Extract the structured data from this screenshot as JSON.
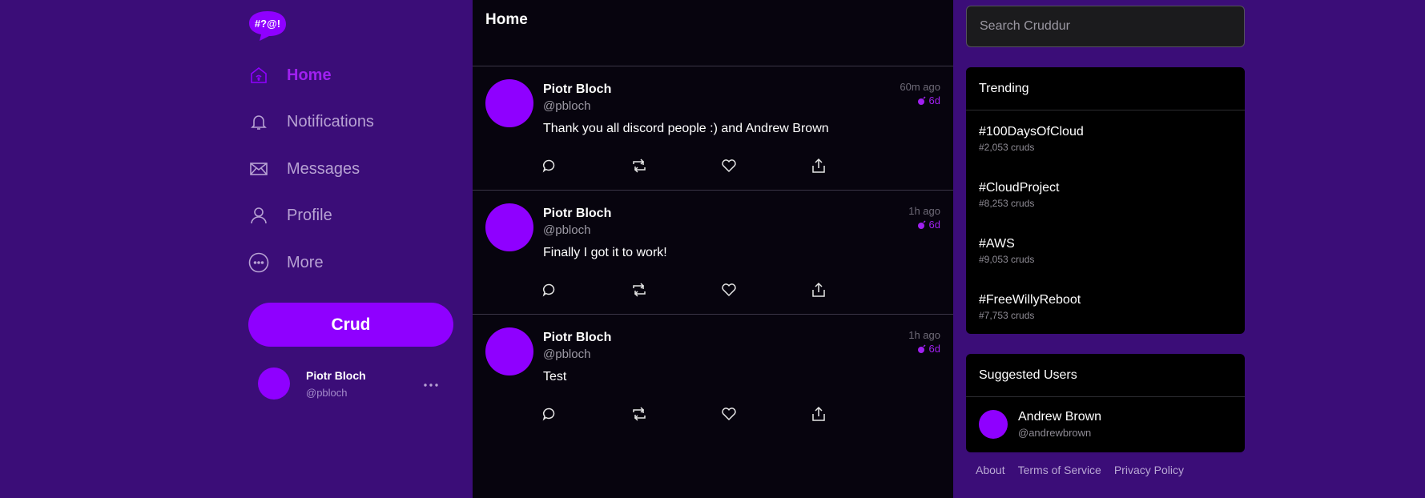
{
  "brand": {
    "logo_text": "#?@!",
    "accent": "#8f00ff",
    "active_color": "#a020f0"
  },
  "nav": {
    "items": [
      {
        "label": "Home",
        "icon": "home-icon",
        "active": true
      },
      {
        "label": "Notifications",
        "icon": "bell-icon",
        "active": false
      },
      {
        "label": "Messages",
        "icon": "envelope-icon",
        "active": false
      },
      {
        "label": "Profile",
        "icon": "user-icon",
        "active": false
      },
      {
        "label": "More",
        "icon": "more-circle-icon",
        "active": false
      }
    ],
    "crud_button": "Crud"
  },
  "current_user": {
    "display_name": "Piotr Bloch",
    "handle": "@pbloch",
    "menu_icon": "ellipsis-icon"
  },
  "feed": {
    "title": "Home",
    "posts": [
      {
        "author": "Piotr Bloch",
        "handle": "@pbloch",
        "message": "Thank you all discord people :) and Andrew Brown",
        "time": "60m ago",
        "expires": "6d"
      },
      {
        "author": "Piotr Bloch",
        "handle": "@pbloch",
        "message": "Finally I got it to work!",
        "time": "1h ago",
        "expires": "6d"
      },
      {
        "author": "Piotr Bloch",
        "handle": "@pbloch",
        "message": "Test",
        "time": "1h ago",
        "expires": "6d"
      }
    ],
    "action_icons": [
      "reply-icon",
      "repost-icon",
      "like-icon",
      "share-icon"
    ]
  },
  "search": {
    "placeholder": "Search Cruddur",
    "value": ""
  },
  "trending": {
    "title": "Trending",
    "items": [
      {
        "tag": "#100DaysOfCloud",
        "count": "#2,053 cruds"
      },
      {
        "tag": "#CloudProject",
        "count": "#8,253 cruds"
      },
      {
        "tag": "#AWS",
        "count": "#9,053 cruds"
      },
      {
        "tag": "#FreeWillyReboot",
        "count": "#7,753 cruds"
      }
    ]
  },
  "suggested": {
    "title": "Suggested Users",
    "users": [
      {
        "display_name": "Andrew Brown",
        "handle": "@andrewbrown"
      }
    ]
  },
  "footer": {
    "links": [
      "About",
      "Terms of Service",
      "Privacy Policy"
    ]
  }
}
